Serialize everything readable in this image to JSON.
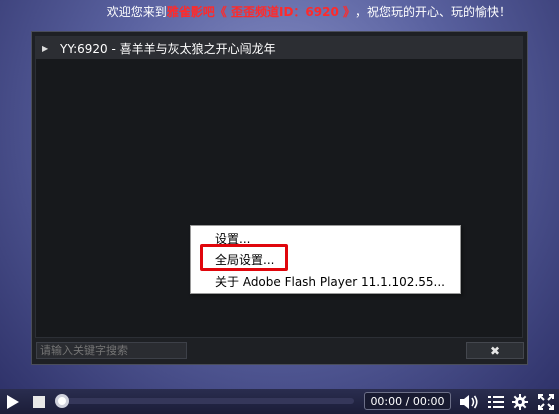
{
  "header": {
    "prefix": "欢迎您来到",
    "highlight": "雅雀影吧《 歪歪频道ID：6920 》",
    "suffix": "，祝您玩的开心、玩的愉快！"
  },
  "playlist": {
    "items": [
      {
        "label": "YY:6920 - 喜羊羊与灰太狼之开心闯龙年"
      }
    ]
  },
  "search": {
    "placeholder": "请输入关键字搜索",
    "value": ""
  },
  "close_button": {
    "label": "✖"
  },
  "context_menu": {
    "items": [
      {
        "label": "设置..."
      },
      {
        "label": "全局设置..."
      },
      {
        "label": "关于 Adobe Flash Player 11.1.102.55..."
      }
    ]
  },
  "controls": {
    "time": "00:00 / 00:00",
    "progress_fraction": 0.0,
    "icons": [
      "play-icon",
      "stop-icon",
      "volume-icon",
      "playlist-icon",
      "gear-icon",
      "fullscreen-icon"
    ]
  },
  "colors": {
    "highlight_red": "#ff2a2a",
    "callout_red": "#e0060c"
  }
}
